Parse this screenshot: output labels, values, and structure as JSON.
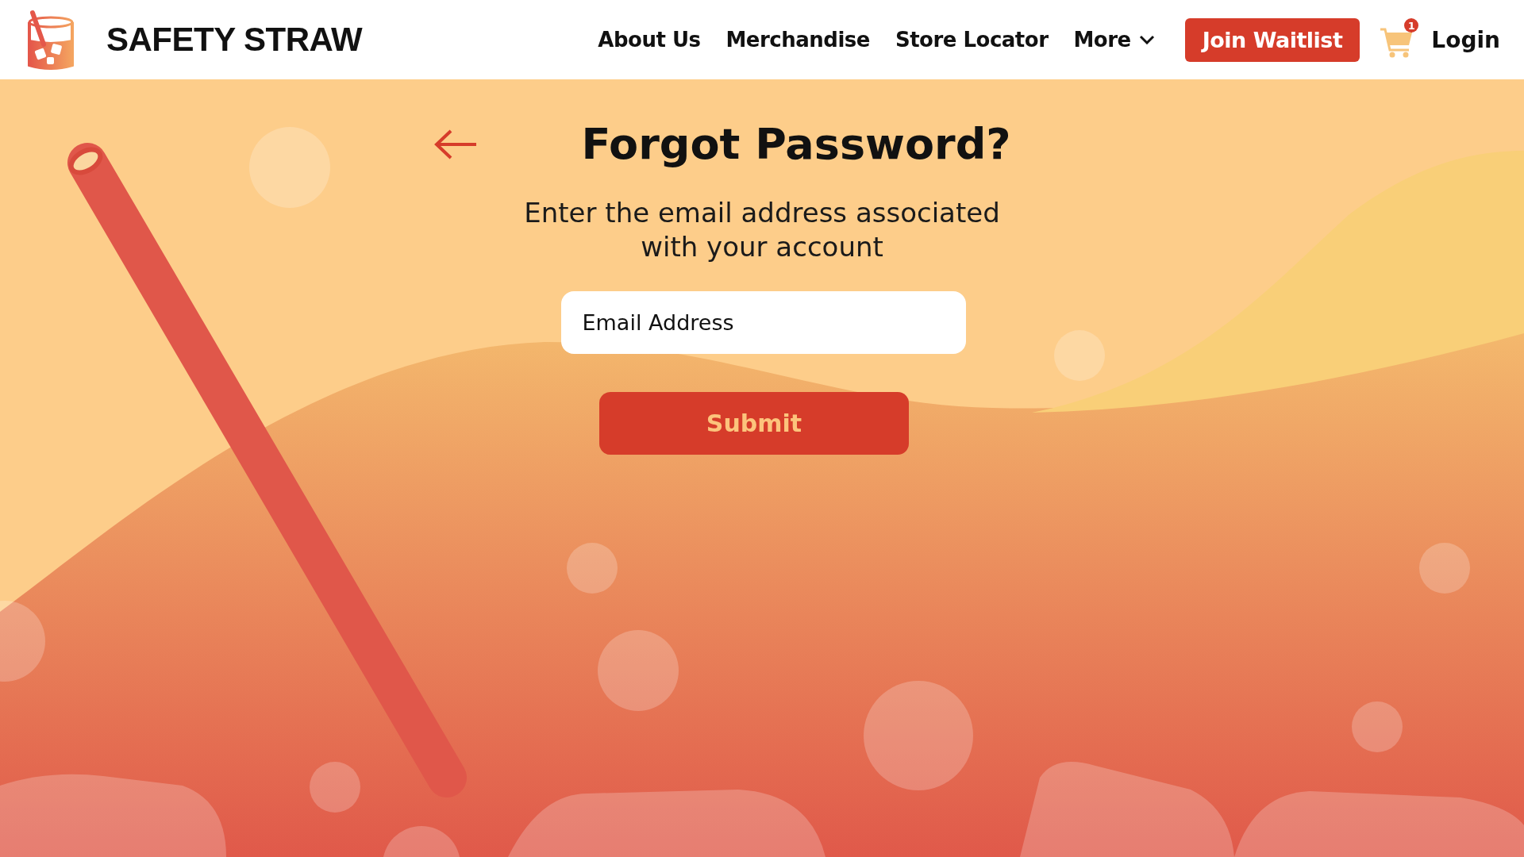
{
  "header": {
    "brand": "SAFETY STRAW",
    "nav": [
      {
        "label": "About Us",
        "has_menu": false
      },
      {
        "label": "Merchandise",
        "has_menu": false
      },
      {
        "label": "Store Locator",
        "has_menu": false
      },
      {
        "label": "More",
        "has_menu": true
      }
    ],
    "cta": "Join Waitlist",
    "cart_count": "1",
    "login": "Login"
  },
  "form": {
    "title": "Forgot Password?",
    "subtitle": "Enter the email address associated with your account",
    "email": {
      "placeholder": "Email Address"
    },
    "submit": "Submit"
  }
}
